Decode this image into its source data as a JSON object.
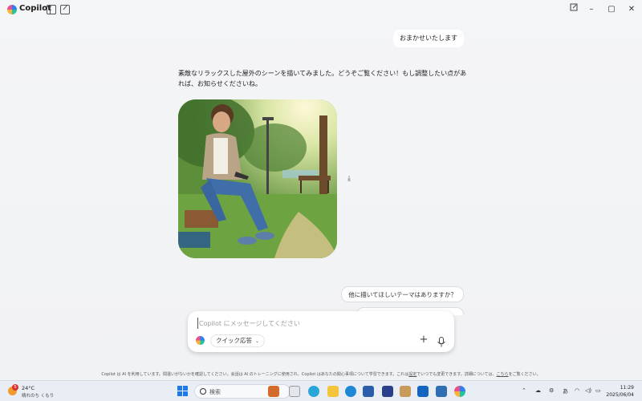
{
  "app": {
    "title": "Copilot"
  },
  "window_controls": {
    "minimize": "–",
    "maximize": "▢",
    "close": "✕"
  },
  "chat": {
    "user_message_1": "おまかせいたします",
    "assistant_message": "素敵なリラックスした屋外のシーンを描いてみました。どうぞご覧ください！もし調整したい点があれば、お知らせくださいね。",
    "image": {
      "subject": "man sitting in a sunny park looking at a phone",
      "palette": [
        "#6fa24a",
        "#3e6b2a",
        "#f4e6b0",
        "#3b5f9c"
      ]
    },
    "suggestion_1": "他に描いてほしいテーマはありますか？"
  },
  "composer": {
    "placeholder": "Copilot にメッセージしてください",
    "mode_label": "クイック応答"
  },
  "footer": {
    "note_prefix": "Copilot は AI を利用しています。間違いがないかを確認してください。会話は AI のトレーニングに使用され、Copilot はあなたの関心事項について学習できます。これは",
    "link_settings": "設定",
    "note_mid": "でいつでも変更できます。詳細については、",
    "link_here": "こちら",
    "note_suffix": "をご覧ください。"
  },
  "taskbar": {
    "weather_temp": "24°C",
    "weather_desc": "晴れのち くもり",
    "weather_badge": "5",
    "search_label": "検索",
    "ime": "あ",
    "time": "11:29",
    "date": "2025/06/04"
  },
  "colors": {
    "accent": "#1f7ae8",
    "background": "#f2f3f5"
  }
}
